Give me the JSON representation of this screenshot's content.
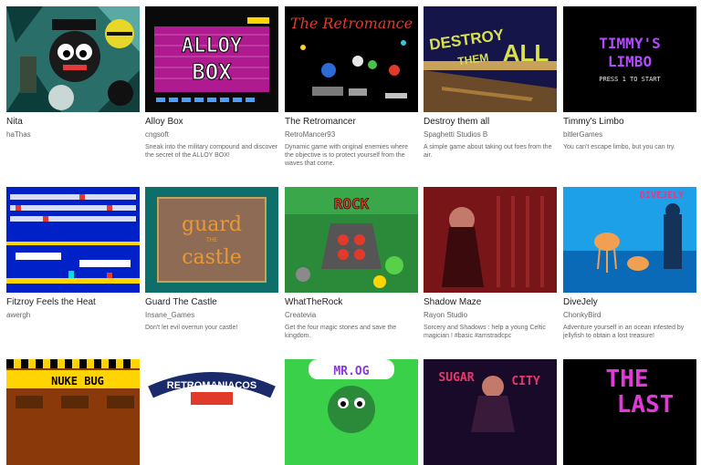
{
  "games": [
    {
      "title": "Nita",
      "author": "haThas",
      "description": "",
      "thumb_text": ""
    },
    {
      "title": "Alloy Box",
      "author": "cngsoft",
      "description": "Sneak into the military compound and discover the secret of the ALLOY BOX!",
      "thumb_text": "ALLOY BOX"
    },
    {
      "title": "The Retromancer",
      "author": "RetroMancer93",
      "description": "Dynamic game with original enemies where the objective is to protect yourself from the waves that come.",
      "thumb_text": "The Retromance"
    },
    {
      "title": "Destroy them all",
      "author": "Spaghetti Studios B",
      "description": "A simple game about taking out foes from the air.",
      "thumb_text": "DESTROY THEM ALL"
    },
    {
      "title": "Timmy's Limbo",
      "author": "bitlerGames",
      "description": "You can't escape limbo, but you can try.",
      "thumb_text": "TIMMY'S LIMBO",
      "thumb_subtext": "PRESS 1 TO START"
    },
    {
      "title": "Fitzroy Feels the Heat",
      "author": "awergh",
      "description": "",
      "thumb_text": ""
    },
    {
      "title": "Guard The Castle",
      "author": "Insane_Games",
      "description": "Don't let evil overrun your castle!",
      "thumb_text": "guard the castle"
    },
    {
      "title": "WhatTheRock",
      "author": "Createvia",
      "description": "Get the four magic stones and save the kingdom.",
      "thumb_text": "ROCK"
    },
    {
      "title": "Shadow Maze",
      "author": "Rayon Studio",
      "description": "Sorcery and Shadows : help a young Celtic magician ! #basic #amstradcpc",
      "thumb_text": ""
    },
    {
      "title": "DiveJely",
      "author": "ChonkyBird",
      "description": "Adventure yourself in an ocean infested by jellyfish to obtain a lost treasure!",
      "thumb_text": "DIVEJELY"
    },
    {
      "title": "",
      "author": "",
      "description": "",
      "thumb_text": "NUKE BUG"
    },
    {
      "title": "",
      "author": "",
      "description": "",
      "thumb_text": "RETROMANIACOS"
    },
    {
      "title": "",
      "author": "",
      "description": "",
      "thumb_text": "MR.OG"
    },
    {
      "title": "",
      "author": "",
      "description": "",
      "thumb_text": "SUGAR CITY"
    },
    {
      "title": "",
      "author": "",
      "description": "",
      "thumb_text": "THE LAST"
    }
  ],
  "colors": {
    "title": "#222222",
    "author": "#666666",
    "description": "#666666"
  }
}
